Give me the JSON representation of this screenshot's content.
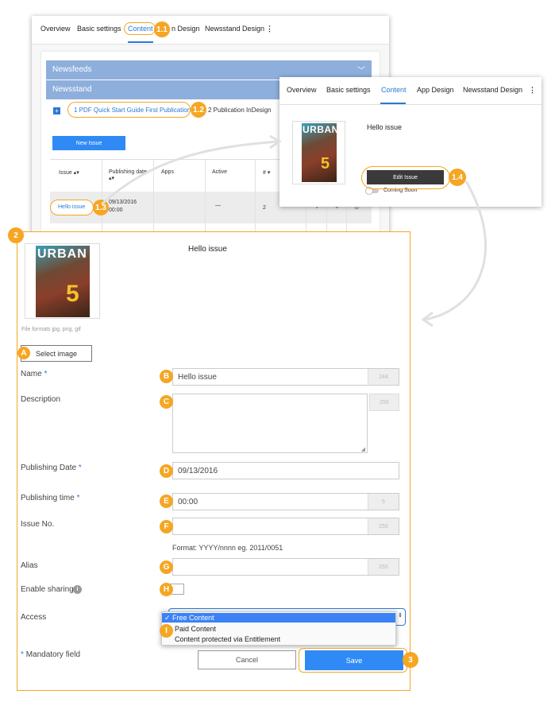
{
  "back_panel": {
    "tabs": [
      "Overview",
      "Basic settings",
      "Content",
      "App Design",
      "Newsstand Design"
    ],
    "active_tab_label": "Content",
    "partial_tab_label": "n Design",
    "newsfeeds_label": "Newsfeeds",
    "newsstand_label": "Newsstand",
    "publication_1": "1 PDF Quick Start Guide First Publication",
    "publication_2": "2 Publication InDesign",
    "new_issue_button": "New Issue",
    "table_headers": {
      "issue": "Issue",
      "publishing_date": "Publishing date",
      "apps": "Apps",
      "active": "Active",
      "number": "#"
    },
    "row": {
      "issue": "Hello issue",
      "date": "09/13/2016",
      "time": "00:00",
      "active": "—",
      "number": "2"
    }
  },
  "popup": {
    "tabs": [
      "Overview",
      "Basic settings",
      "Content",
      "App Design",
      "Newsstand Design"
    ],
    "active_tab": "Content",
    "title": "Hello issue",
    "edit_button": "Edit Issue",
    "coming_soon": "Coming Soon"
  },
  "cover": {
    "brand": "URBAN"
  },
  "form": {
    "title": "Hello issue",
    "file_formats": "File formats jpg, png, gif",
    "select_image": "Select image",
    "name_label": "Name",
    "name_value": "Hello issue",
    "name_counter": "244",
    "description_label": "Description",
    "description_counter": "255",
    "publishing_date_label": "Publishing Date",
    "publishing_date_value": "09/13/2016",
    "publishing_time_label": "Publishing time",
    "publishing_time_value": "00:00",
    "publishing_time_counter": "5",
    "issue_no_label": "Issue No.",
    "issue_no_counter": "255",
    "format_hint": "Format: YYYY/nnnn eg. 2011/0051",
    "alias_label": "Alias",
    "alias_counter": "255",
    "enable_sharing_label": "Enable sharing",
    "access_label": "Access",
    "access_options": [
      "Free Content",
      "Paid Content",
      "Content protected via Entitlement"
    ],
    "access_selected": "Free Content",
    "mandatory_note": "Mandatory field",
    "required_marker": "*",
    "cancel_button": "Cancel",
    "save_button": "Save"
  },
  "annotations": {
    "b1_1": "1.1",
    "b1_2": "1.2",
    "b1_3": "1.3",
    "b1_4": "1.4",
    "b2": "2",
    "b3": "3",
    "bA": "A",
    "bB": "B",
    "bC": "C",
    "bD": "D",
    "bE": "E",
    "bF": "F",
    "bG": "G",
    "bH": "H",
    "bI": "I"
  },
  "colors": {
    "accent": "#2979d8",
    "badge": "#f5a623",
    "header_band": "#8eaedc",
    "save": "#2f8af5",
    "dark_button": "#3a3a3a"
  }
}
